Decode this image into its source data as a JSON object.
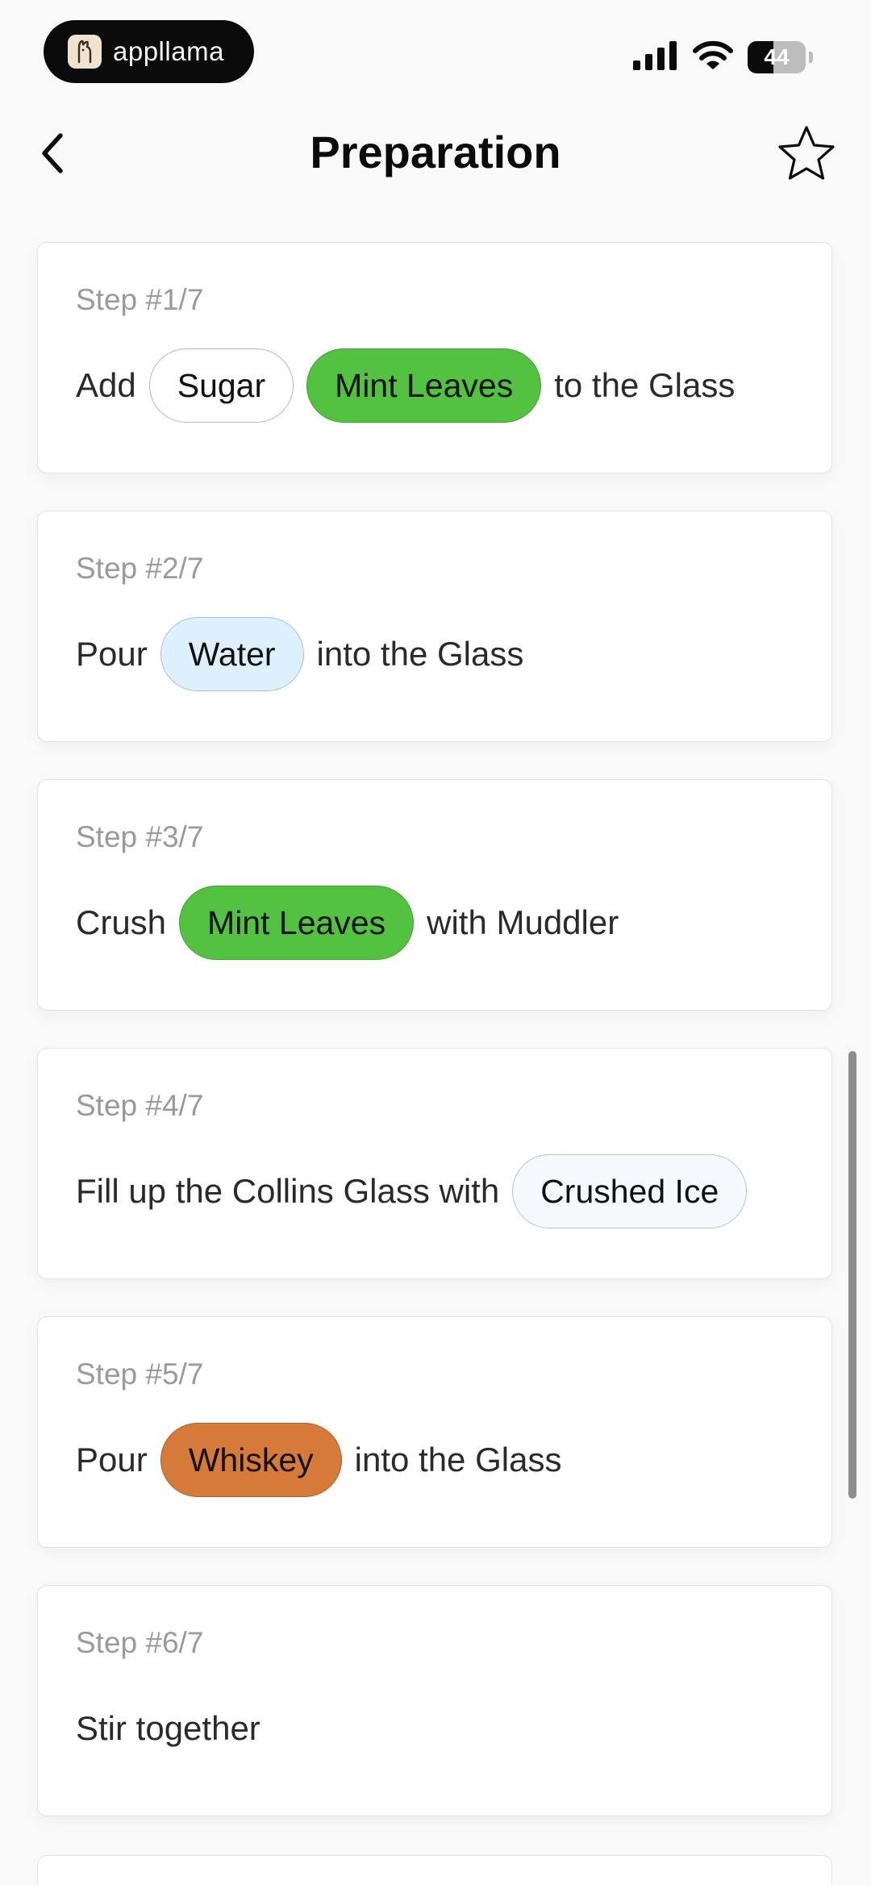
{
  "status_bar": {
    "app_name": "appllama",
    "battery": "44",
    "battery_level": 0.44,
    "icons": [
      "llama-logo-icon",
      "signal-icon",
      "wifi-icon",
      "battery-icon"
    ]
  },
  "header": {
    "title": "Preparation",
    "icons": [
      "chevron-left-icon",
      "star-outline-icon"
    ]
  },
  "steps": [
    {
      "label": "Step #1/7",
      "w1": "Add",
      "chip1": "Sugar",
      "chip2": "Mint Leaves",
      "w2": "to the Glass"
    },
    {
      "label": "Step #2/7",
      "w1": "Pour",
      "chip1": "Water",
      "w2": "into the Glass"
    },
    {
      "label": "Step #3/7",
      "w1": "Crush",
      "chip1": "Mint Leaves",
      "w2": "with Muddler"
    },
    {
      "label": "Step #4/7",
      "w1": "Fill up the Collins Glass with",
      "chip1": "Crushed Ice"
    },
    {
      "label": "Step #5/7",
      "w1": "Pour",
      "chip1": "Whiskey",
      "w2": "into the Glass"
    },
    {
      "label": "Step #6/7",
      "w1": "Stir together"
    }
  ],
  "colors": {
    "mint": "#52c240",
    "water": "#ddf0fd",
    "ice": "#f3f9fd",
    "whiskey": "#d67a3a"
  }
}
